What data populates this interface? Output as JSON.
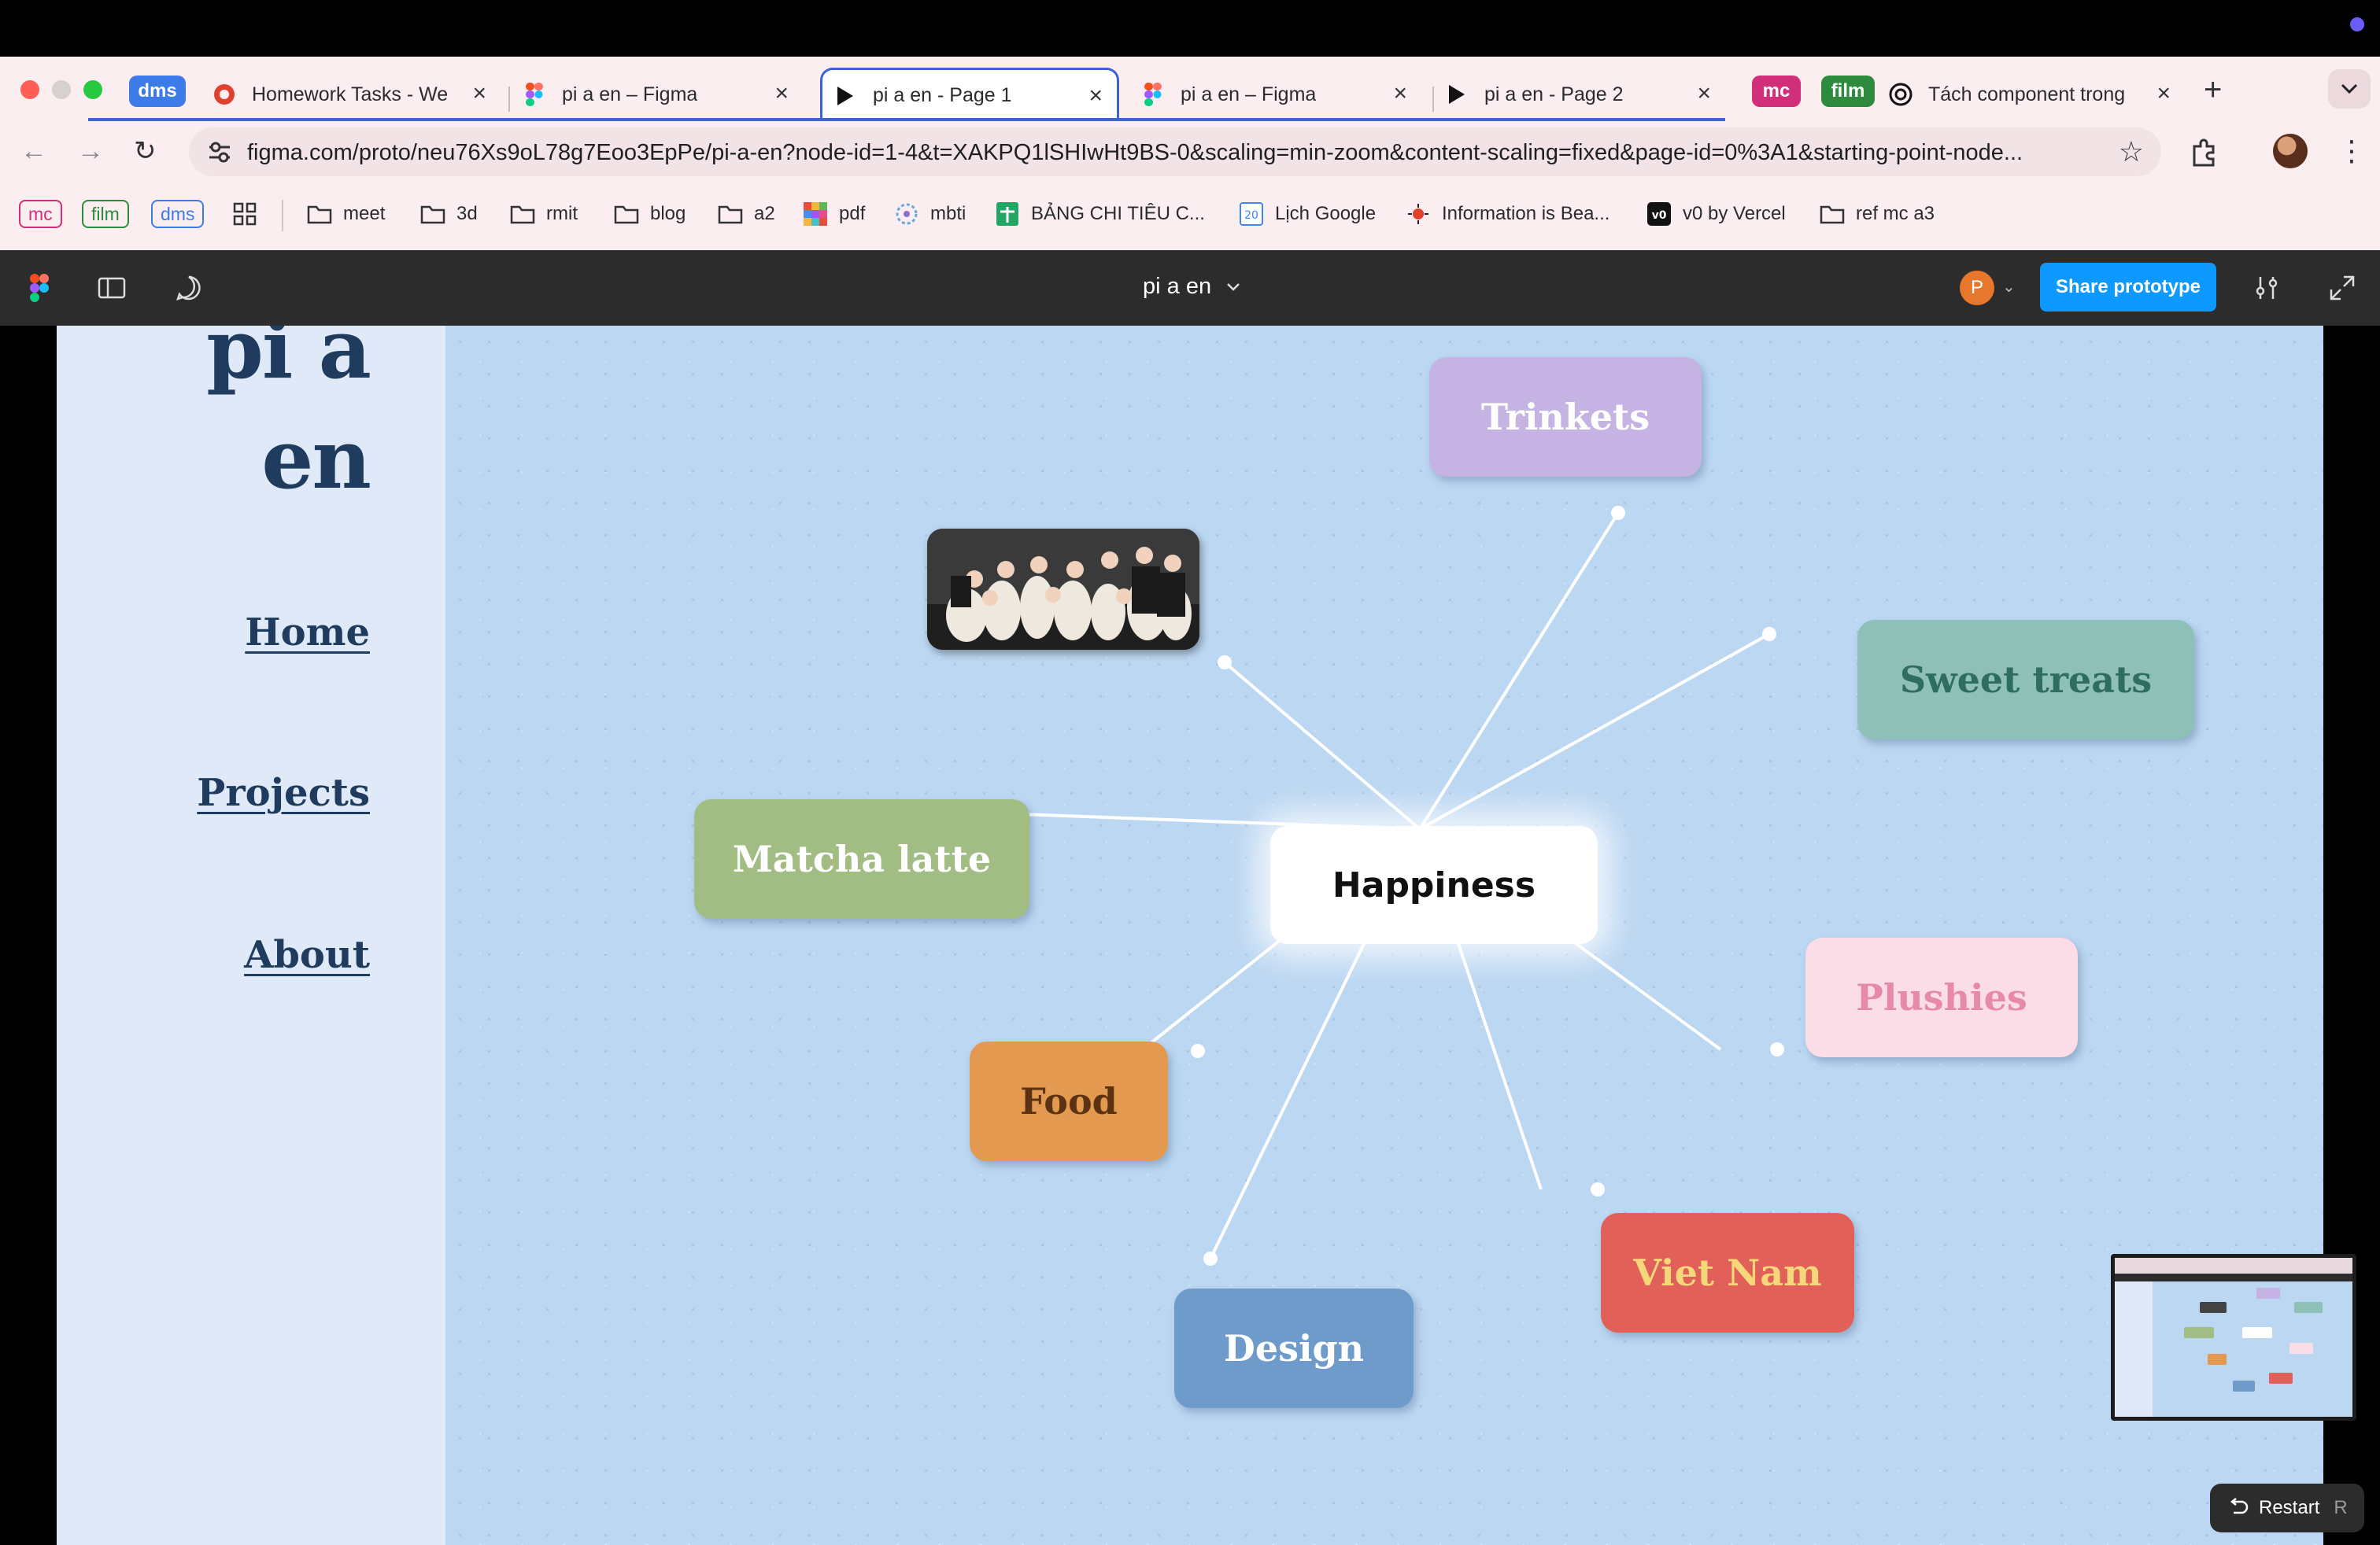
{
  "tab_groups": [
    {
      "label": "dms",
      "color": "#3d7be8"
    },
    {
      "label": "mc",
      "color": "#d12f7a"
    },
    {
      "label": "film",
      "color": "#2e8b3e"
    }
  ],
  "tabs": [
    {
      "title": "Homework Tasks - We",
      "icon": "homework-icon",
      "active": false
    },
    {
      "title": "pi a en – Figma",
      "icon": "figma-icon",
      "active": false
    },
    {
      "title": "pi a en - Page 1",
      "icon": "play-icon",
      "active": true
    },
    {
      "title": "pi a en – Figma",
      "icon": "figma-icon",
      "active": false
    },
    {
      "title": "pi a en - Page 2",
      "icon": "play-icon",
      "active": false
    },
    {
      "title": "Tách component trong",
      "icon": "openai-icon",
      "active": false
    }
  ],
  "address_bar": {
    "url": "figma.com/proto/neu76Xs9oL78g7Eoo3EpPe/pi-a-en?node-id=1-4&t=XAKPQ1lSHIwHt9BS-0&scaling=min-zoom&content-scaling=fixed&page-id=0%3A1&starting-point-node..."
  },
  "bookmarks": {
    "pills": [
      {
        "label": "mc",
        "color": "#d12f7a"
      },
      {
        "label": "film",
        "color": "#2e8b3e"
      },
      {
        "label": "dms",
        "color": "#3d7be8"
      }
    ],
    "items": [
      {
        "label": "meet",
        "icon": "folder-icon"
      },
      {
        "label": "3d",
        "icon": "folder-icon"
      },
      {
        "label": "rmit",
        "icon": "folder-icon"
      },
      {
        "label": "blog",
        "icon": "folder-icon"
      },
      {
        "label": "a2",
        "icon": "folder-icon"
      },
      {
        "label": "pdf",
        "icon": "pdf-icon"
      },
      {
        "label": "mbti",
        "icon": "mbti-icon"
      },
      {
        "label": "BẢNG CHI TIÊU C...",
        "icon": "sheets-icon"
      },
      {
        "label": "Lịch Google",
        "icon": "calendar-icon"
      },
      {
        "label": "Information is Bea...",
        "icon": "info-icon"
      },
      {
        "label": "v0 by Vercel",
        "icon": "v0-icon"
      },
      {
        "label": "ref mc a3",
        "icon": "folder-icon"
      }
    ]
  },
  "figma": {
    "file_title": "pi a en",
    "avatar_initial": "P",
    "share_label": "Share prototype"
  },
  "site": {
    "logo_line1": "pi a",
    "logo_line2": "en",
    "nav": [
      "Home",
      "Projects",
      "About"
    ]
  },
  "mindmap": {
    "center": "Happiness",
    "nodes": [
      {
        "label": "Trinkets",
        "bg": "#c5b4e3",
        "fg": "#ffffff"
      },
      {
        "label": "Sweet treats",
        "bg": "#8fc0b8",
        "fg": "#2f6d63"
      },
      {
        "label": "Matcha latte",
        "bg": "#a1bd84",
        "fg": "#ffffff"
      },
      {
        "label": "Plushies",
        "bg": "#fadde6",
        "fg": "#e68aa8"
      },
      {
        "label": "Food",
        "bg": "#e3994f",
        "fg": "#5b3212"
      },
      {
        "label": "Viet Nam",
        "bg": "#e2605a",
        "fg": "#f6d77a"
      },
      {
        "label": "Design",
        "bg": "#6f9bcb",
        "fg": "#ffffff"
      }
    ]
  },
  "controls": {
    "restart_label": "Restart",
    "restart_key": "R"
  }
}
